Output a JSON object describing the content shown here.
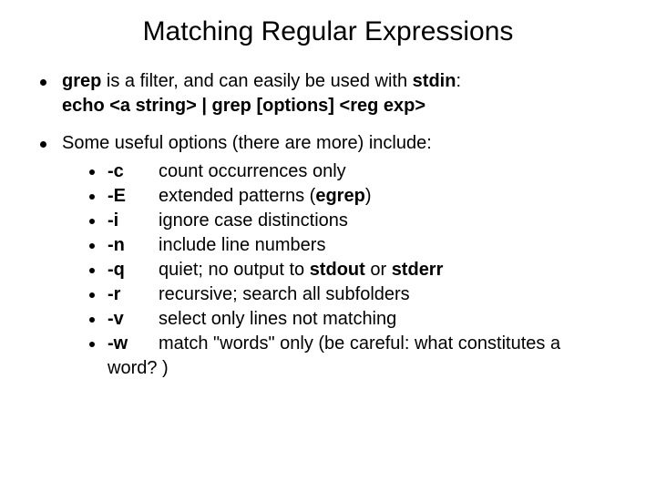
{
  "title": "Matching Regular Expressions",
  "point1": {
    "grep": "grep",
    "t1": " is a filter, and can easily be used with ",
    "stdin": "stdin",
    "t2": ":",
    "cmd": "echo <a string> | grep [options] <reg exp>"
  },
  "point2": {
    "intro": "Some useful options (there are more) include:",
    "options": [
      {
        "flag": "-c",
        "desc_pre": "count occurrences only",
        "b1": "",
        "mid": "",
        "b2": "",
        "post": ""
      },
      {
        "flag": "-E",
        "desc_pre": "extended patterns (",
        "b1": "egrep",
        "mid": ")",
        "b2": "",
        "post": ""
      },
      {
        "flag": "-i",
        "desc_pre": "ignore case distinctions",
        "b1": "",
        "mid": "",
        "b2": "",
        "post": ""
      },
      {
        "flag": "-n",
        "desc_pre": "include line numbers",
        "b1": "",
        "mid": "",
        "b2": "",
        "post": ""
      },
      {
        "flag": "-q",
        "desc_pre": "quiet; no output to ",
        "b1": "stdout",
        "mid": " or ",
        "b2": "stderr",
        "post": ""
      },
      {
        "flag": "-r",
        "desc_pre": "recursive; search all subfolders",
        "b1": "",
        "mid": "",
        "b2": "",
        "post": ""
      },
      {
        "flag": "-v",
        "desc_pre": "select only lines not matching",
        "b1": "",
        "mid": "",
        "b2": "",
        "post": ""
      },
      {
        "flag": "-w",
        "desc_pre": "match \"words\" only (be careful: what constitutes a",
        "b1": "",
        "mid": "",
        "b2": "",
        "post": ""
      }
    ],
    "trail": "word? )"
  }
}
